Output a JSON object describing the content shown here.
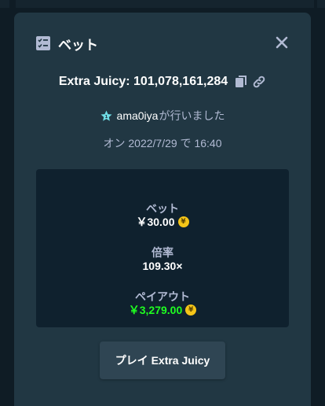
{
  "modal": {
    "title": "ベット",
    "game_label": "Extra Juicy: 101,078,161,284",
    "placed_by_user": "ama0iya",
    "placed_by_suffix": "が行いました",
    "date_text": "オン 2022/7/29 で 16:40",
    "stats": {
      "bet_label": "ベット",
      "bet_value": "￥30.00",
      "multiplier_label": "倍率",
      "multiplier_value": "109.30×",
      "payout_label": "ペイアウト",
      "payout_value": "￥3,279.00"
    },
    "currency_symbol": "¥",
    "play_button_label": "プレイ Extra Juicy"
  },
  "colors": {
    "modal_bg": "#213743",
    "panel_bg": "#0f212e",
    "page_bg": "#0f1c25",
    "muted_text": "#b1bad3",
    "payout_green": "#1fff20",
    "coin_gold": "#f5c518",
    "star_cyan": "#6fdde6",
    "button_bg": "#2f4553"
  },
  "icons": {
    "header": "bet-slip-icon",
    "close": "close-icon",
    "copy": "copy-icon",
    "link": "link-icon",
    "vip": "vip-star-icon",
    "coin": "yen-coin-icon"
  }
}
